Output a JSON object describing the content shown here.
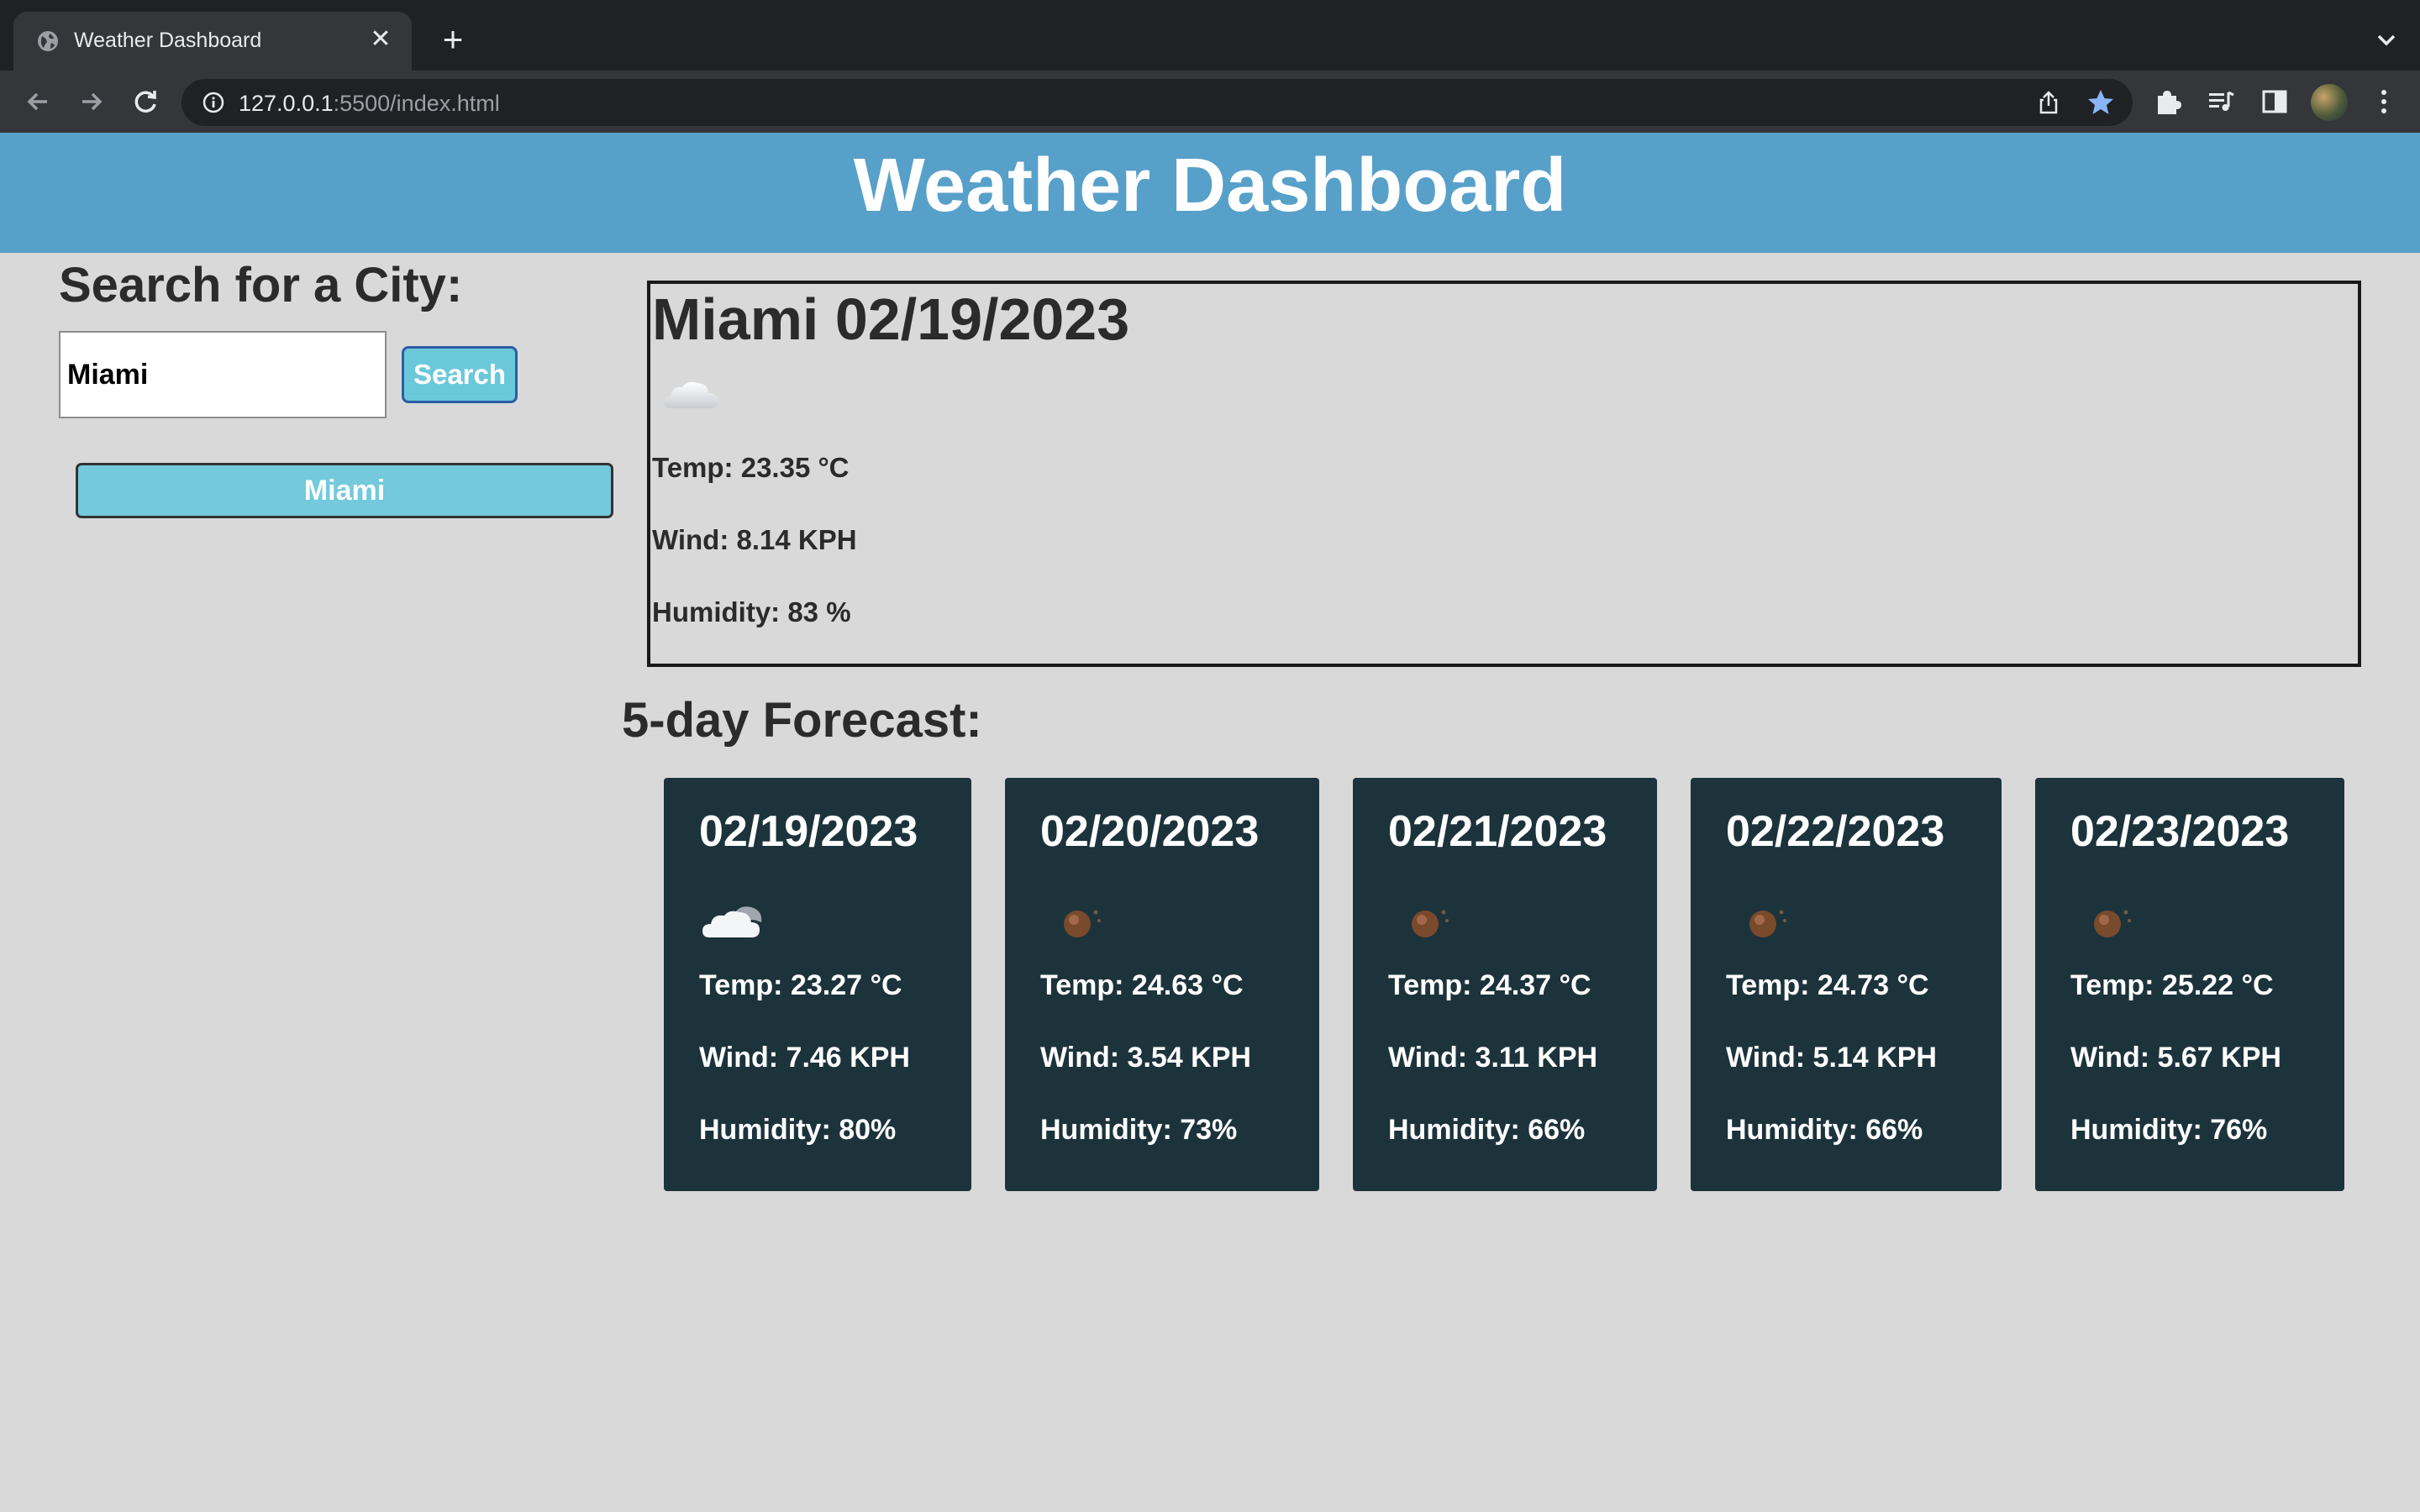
{
  "browser": {
    "tab_title": "Weather Dashboard",
    "url_host": "127.0.0.1",
    "url_rest": ":5500/index.html"
  },
  "app": {
    "title": "Weather Dashboard",
    "accent_color": "#57a0c9",
    "card_color": "#1c333c"
  },
  "search": {
    "heading": "Search for a City:",
    "input_value": "Miami",
    "button_label": "Search",
    "history": [
      "Miami"
    ]
  },
  "current": {
    "title": "Miami 02/19/2023",
    "icon": "cloud-icon",
    "temp": "Temp: 23.35 °C",
    "wind": "Wind: 8.14 KPH",
    "humidity": "Humidity: 83 %"
  },
  "forecast": {
    "heading": "5-day Forecast:",
    "days": [
      {
        "date": "02/19/2023",
        "icon": "partly-cloudy-icon",
        "temp": "Temp: 23.27 °C",
        "wind": "Wind: 7.46 KPH",
        "humidity": "Humidity: 80%"
      },
      {
        "date": "02/20/2023",
        "icon": "clear-night-icon",
        "temp": "Temp: 24.63 °C",
        "wind": "Wind: 3.54 KPH",
        "humidity": "Humidity: 73%"
      },
      {
        "date": "02/21/2023",
        "icon": "clear-night-icon",
        "temp": "Temp: 24.37 °C",
        "wind": "Wind: 3.11 KPH",
        "humidity": "Humidity: 66%"
      },
      {
        "date": "02/22/2023",
        "icon": "clear-night-icon",
        "temp": "Temp: 24.73 °C",
        "wind": "Wind: 5.14 KPH",
        "humidity": "Humidity: 66%"
      },
      {
        "date": "02/23/2023",
        "icon": "clear-night-icon",
        "temp": "Temp: 25.22 °C",
        "wind": "Wind: 5.67 KPH",
        "humidity": "Humidity: 76%"
      }
    ]
  }
}
